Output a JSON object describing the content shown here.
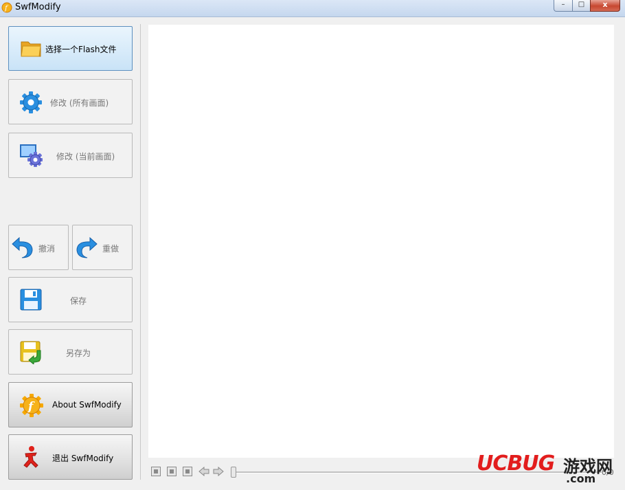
{
  "window": {
    "title": "SwfModify",
    "min": "–",
    "max": "□",
    "close": "x"
  },
  "sidebar": {
    "open_label": "选择一个Flash文件",
    "modify_all_label": "修改 (所有画面)",
    "modify_current_label": "修改 (当前画面)",
    "undo_label": "撤消",
    "redo_label": "重做",
    "save_label": "保存",
    "save_as_label": "另存为",
    "about_label": "About SwfModify",
    "exit_label": "退出 SwfModify"
  },
  "player": {
    "counter": "0/0"
  },
  "watermark": {
    "brand": "UCBUG",
    "cn": "游戏网",
    "tld": ".com"
  },
  "colors": {
    "accent_blue": "#2a8fe0",
    "active_border": "#5b8fbf",
    "watermark_red": "#e21d1d"
  }
}
